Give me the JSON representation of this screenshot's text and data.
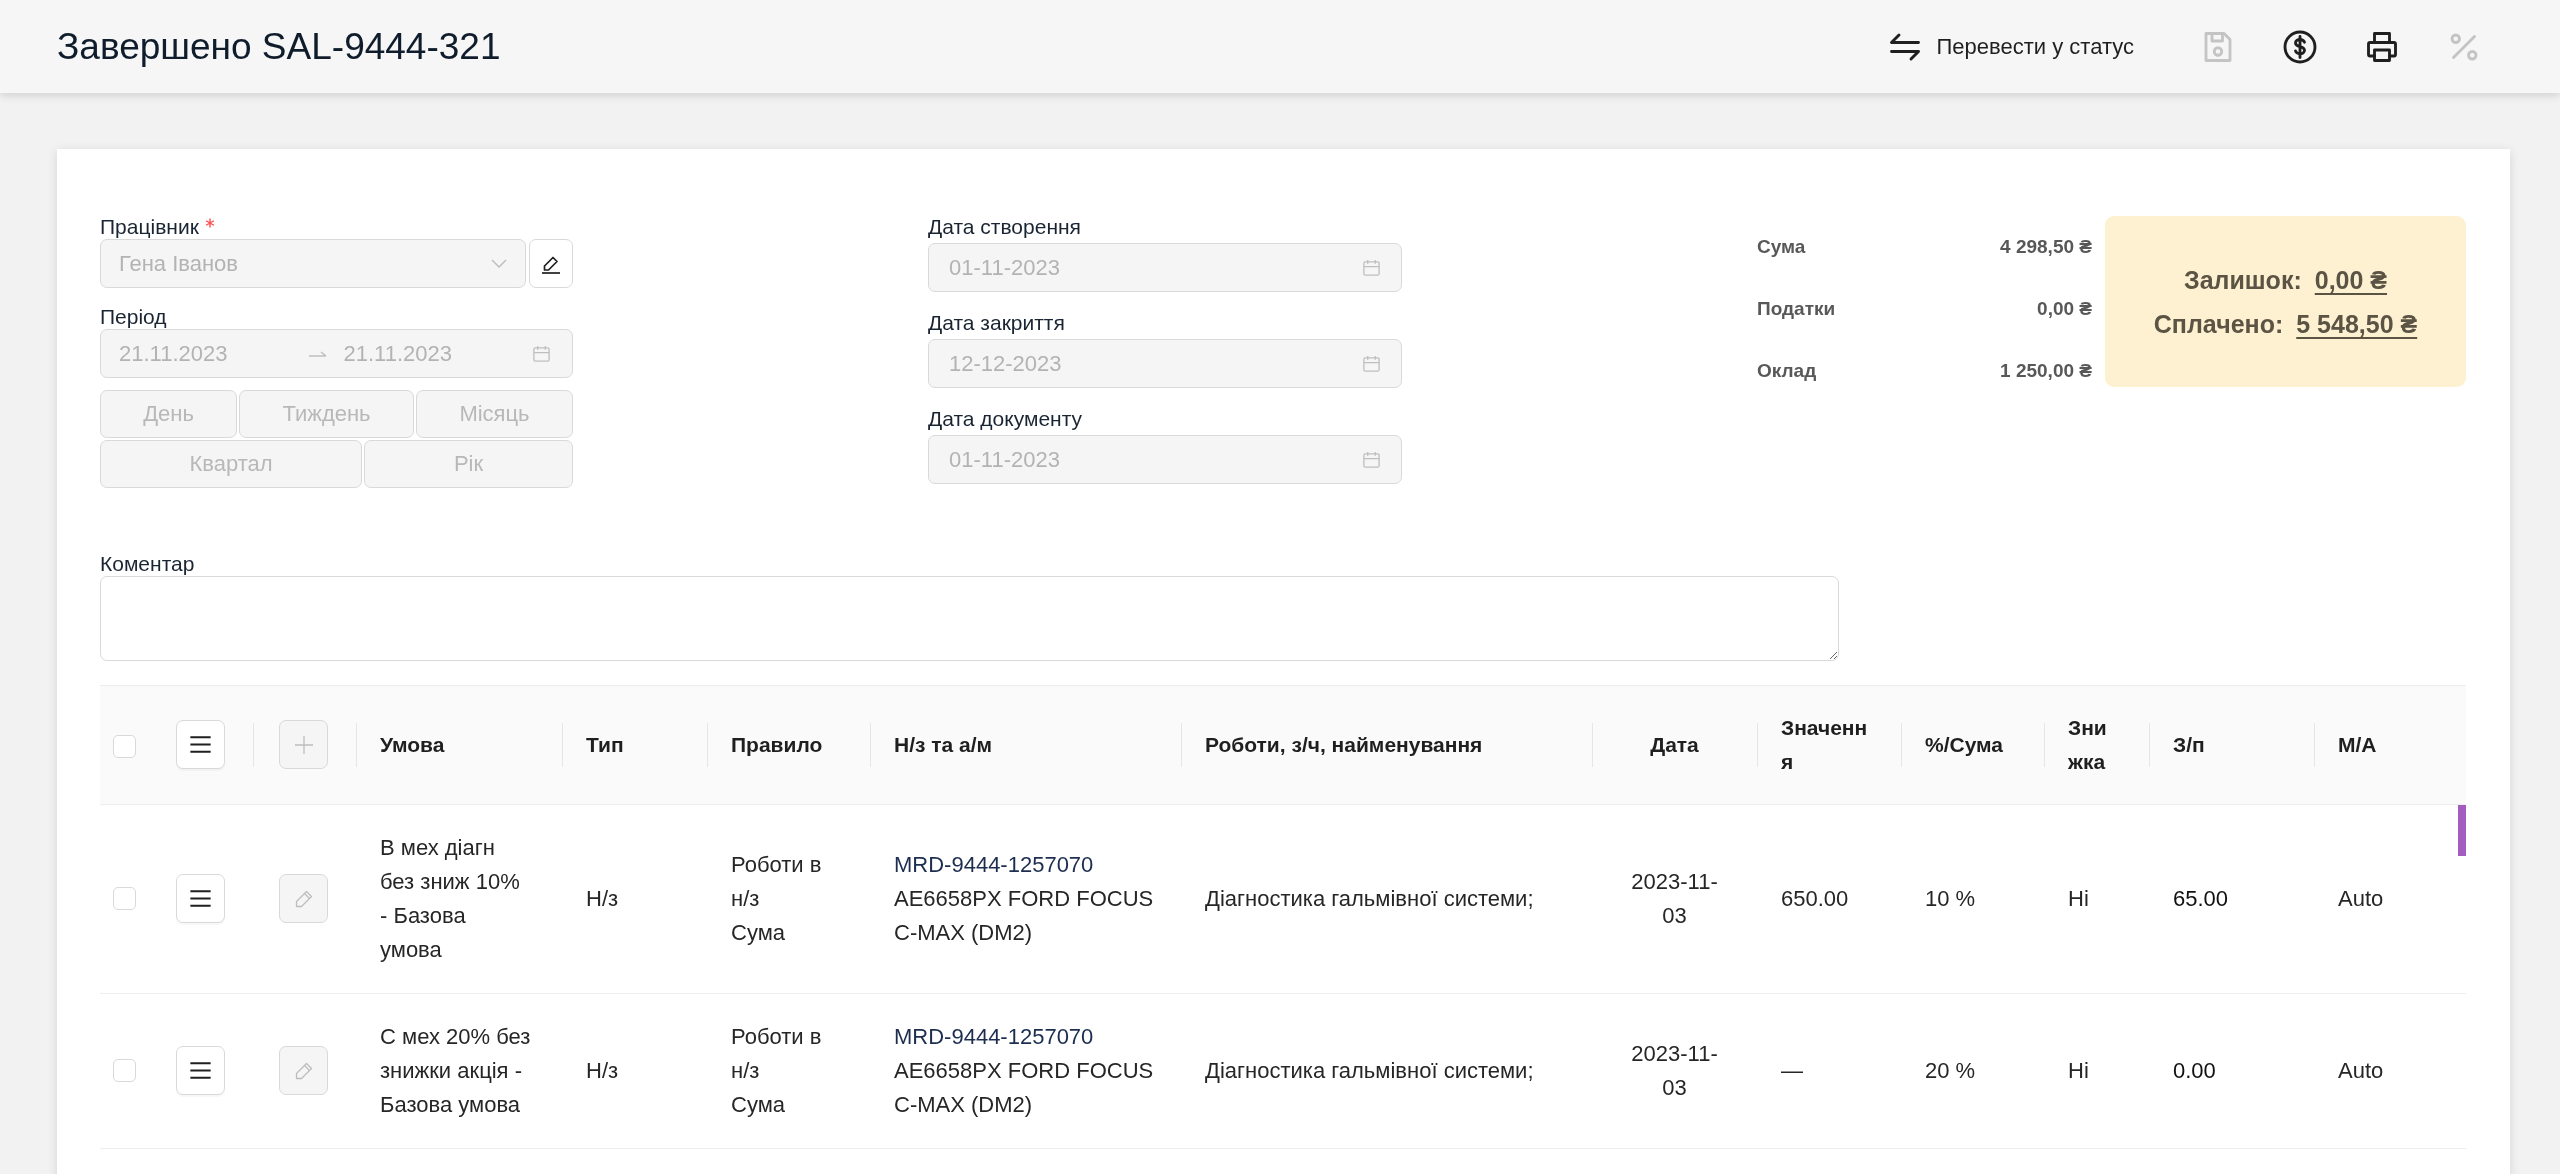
{
  "header": {
    "title": "Завершено SAL-9444-321",
    "actions": [
      {
        "kind": "status",
        "label": "Перевести у статус",
        "disabled": false
      },
      {
        "kind": "save",
        "disabled": true
      },
      {
        "kind": "payment",
        "disabled": false
      },
      {
        "kind": "print",
        "disabled": false
      },
      {
        "kind": "discount",
        "disabled": true
      }
    ]
  },
  "employee": {
    "label": "Працівник",
    "required": true,
    "value": "Гена Іванов",
    "disabled": true
  },
  "period": {
    "label": "Період",
    "from": "21.11.2023",
    "to": "21.11.2023",
    "disabled": true,
    "presets": [
      {
        "label": "День",
        "disabled": true
      },
      {
        "label": "Тиждень",
        "disabled": true
      },
      {
        "label": "Місяць",
        "disabled": true
      },
      {
        "label": "Квартал",
        "disabled": true
      },
      {
        "label": "Рік",
        "disabled": true
      }
    ]
  },
  "dates": [
    {
      "label": "Дата створення",
      "value": "01-11-2023",
      "disabled": true
    },
    {
      "label": "Дата закриття",
      "value": "12-12-2023",
      "disabled": true
    },
    {
      "label": "Дата документу",
      "value": "01-11-2023",
      "disabled": true
    }
  ],
  "summary": [
    {
      "label": "Сума",
      "value": "4 298,50 ₴"
    },
    {
      "label": "Податки",
      "value": "0,00 ₴"
    },
    {
      "label": "Оклад",
      "value": "1 250,00 ₴"
    }
  ],
  "balance": [
    {
      "label": "Залишок:",
      "value": "0,00 ₴"
    },
    {
      "label": "Сплачено:",
      "value": "5 548,50 ₴"
    }
  ],
  "comment": {
    "label": "Коментар"
  },
  "table": {
    "all_selected": false,
    "add_disabled": true,
    "columns": [
      "Умова",
      "Тип",
      "Правило",
      "Н/з та а/м",
      "Роботи, з/ч, найменування",
      "Дата",
      "Значення",
      "%/Сума",
      "Знижка",
      "З/п",
      "М/А"
    ],
    "rows": [
      {
        "selected": false,
        "edit_disabled": true,
        "condition": "В мех діагн без зниж 10% - Базова умова",
        "type": "Н/з",
        "rule": "Роботи в н/з",
        "rule_mode": "Сума",
        "order": "MRD-9444-1257070",
        "vehicle": "AE6658PX FORD FOCUS C-MAX (DM2)",
        "work": "Діагностика гальмівної системи;",
        "date": "2023-11-03",
        "value": "650.00",
        "percent": "10 %",
        "discount": "Ні",
        "salary": "65.00",
        "mode": "Auto"
      },
      {
        "selected": false,
        "edit_disabled": true,
        "condition": "С мех 20% без знижки акція - Базова умова",
        "type": "Н/з",
        "rule": "Роботи в н/з",
        "rule_mode": "Сума",
        "order": "MRD-9444-1257070",
        "vehicle": "AE6658PX FORD FOCUS C-MAX (DM2)",
        "work": "Діагностика гальмівної системи;",
        "date": "2023-11-03",
        "value": "—",
        "percent": "20 %",
        "discount": "Ні",
        "salary": "0.00",
        "mode": "Auto"
      }
    ]
  }
}
